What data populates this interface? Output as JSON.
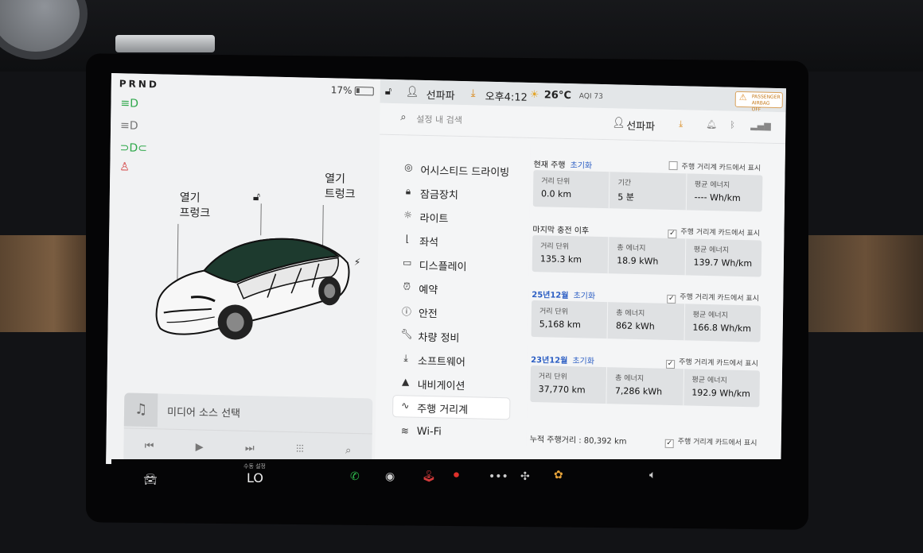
{
  "status": {
    "gear": "PRND",
    "battery_pct": "17%",
    "user": "선파파",
    "time": "오후4:12",
    "temp": "26°C",
    "aqi": "AQI 73",
    "airbag": "PASSENGER AIRBAG OFF"
  },
  "car": {
    "frunk_label": "열기\n프렁크",
    "trunk_label": "열기\n트렁크"
  },
  "media": {
    "source_label": "미디어 소스 선택"
  },
  "settings": {
    "search_placeholder": "설정 내 검색",
    "user": "선파파",
    "menu": [
      {
        "label": "어시스티드 드라이빙",
        "icon": "steering-wheel-icon"
      },
      {
        "label": "잠금장치",
        "icon": "lock-icon"
      },
      {
        "label": "라이트",
        "icon": "light-icon"
      },
      {
        "label": "좌석",
        "icon": "seat-icon"
      },
      {
        "label": "디스플레이",
        "icon": "display-icon"
      },
      {
        "label": "예약",
        "icon": "alarm-icon"
      },
      {
        "label": "안전",
        "icon": "safety-icon"
      },
      {
        "label": "차량 정비",
        "icon": "wrench-icon"
      },
      {
        "label": "소프트웨어",
        "icon": "download-icon"
      },
      {
        "label": "내비게이션",
        "icon": "navigation-icon"
      },
      {
        "label": "주행 거리계",
        "icon": "odometer-icon"
      },
      {
        "label": "Wi-Fi",
        "icon": "wifi-icon"
      }
    ],
    "reset_label": "초기화",
    "show_on_card_label": "주행 거리계 카드에서 표시",
    "sections": [
      {
        "title": "현재 주행",
        "checked": false,
        "cells": [
          {
            "key": "거리 단위",
            "value": "0.0 km"
          },
          {
            "key": "기간",
            "value": "5 분"
          },
          {
            "key": "평균 에너지",
            "value": "---- Wh/km"
          }
        ]
      },
      {
        "title": "마지막 충전 이후",
        "checked": true,
        "cells": [
          {
            "key": "거리 단위",
            "value": "135.3 km"
          },
          {
            "key": "총 에너지",
            "value": "18.9 kWh"
          },
          {
            "key": "평균 에너지",
            "value": "139.7 Wh/km"
          }
        ]
      },
      {
        "title": "25년12월",
        "checked": true,
        "cells": [
          {
            "key": "거리 단위",
            "value": "5,168 km"
          },
          {
            "key": "총 에너지",
            "value": "862 kWh"
          },
          {
            "key": "평균 에너지",
            "value": "166.8 Wh/km"
          }
        ]
      },
      {
        "title": "23년12월",
        "checked": true,
        "cells": [
          {
            "key": "거리 단위",
            "value": "37,770 km"
          },
          {
            "key": "총 에너지",
            "value": "7,286 kWh"
          },
          {
            "key": "평균 에너지",
            "value": "192.9 Wh/km"
          }
        ]
      }
    ],
    "cumulative": "누적 주행거리 : 80,392 km"
  },
  "bottom": {
    "climate_caption": "수동 설정",
    "climate_value": "LO"
  }
}
